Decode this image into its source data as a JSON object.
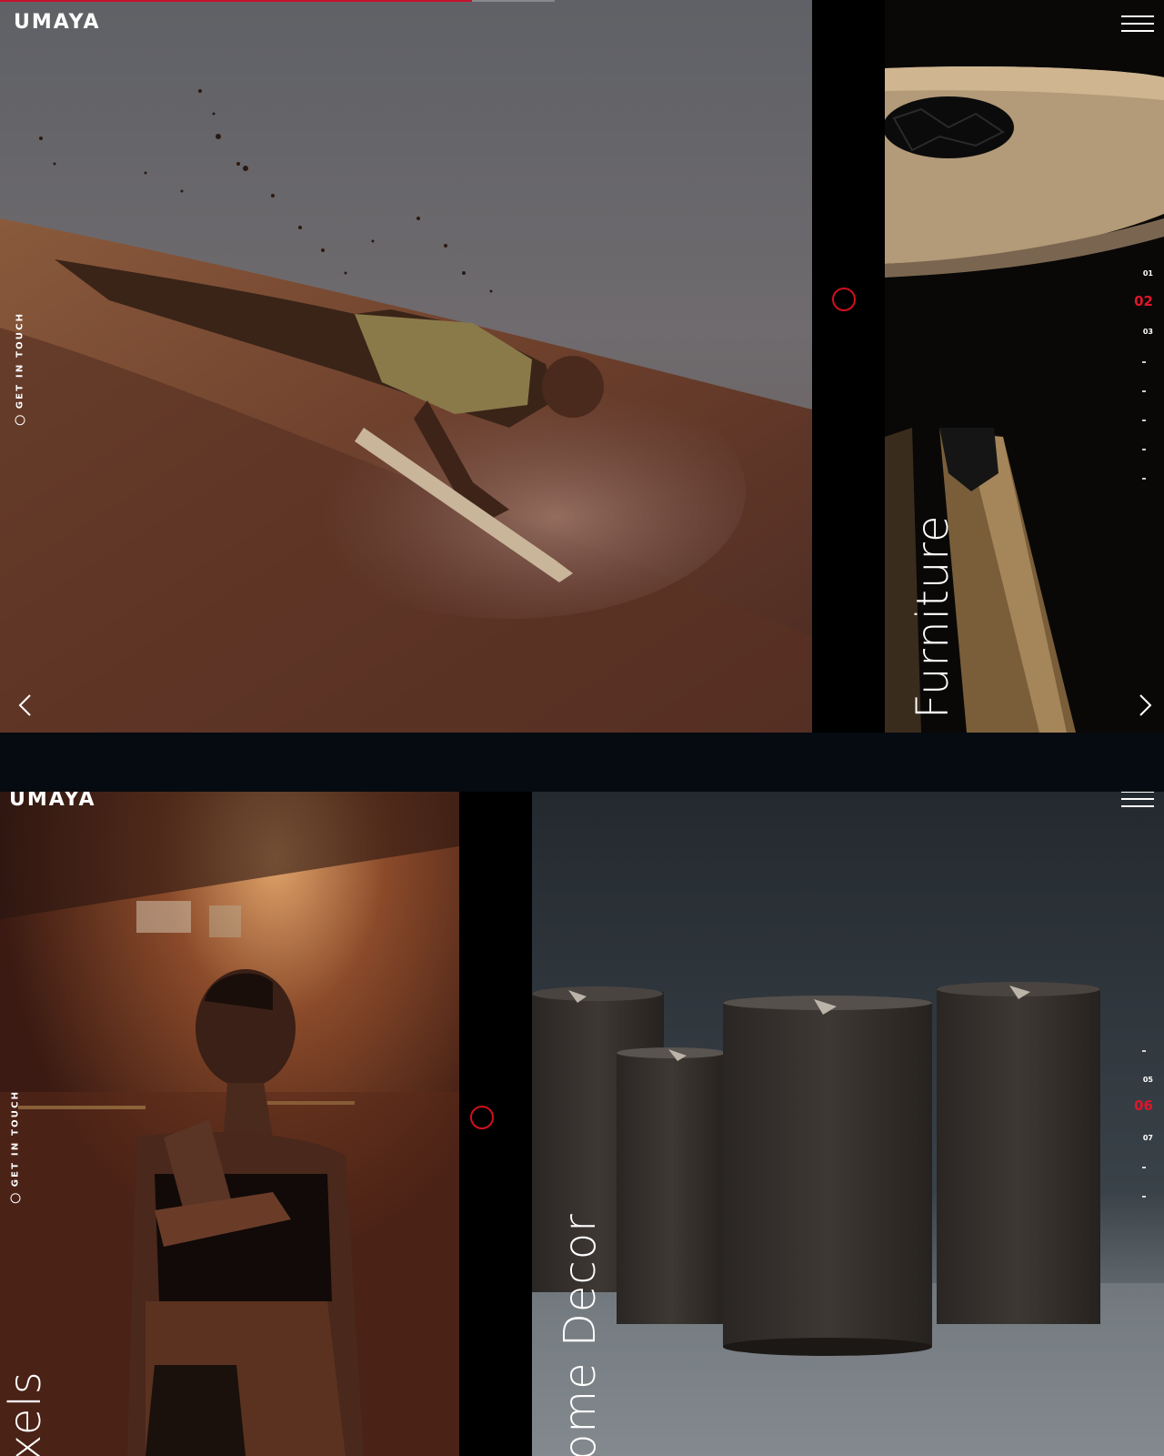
{
  "brand": {
    "logo_text": "UMAYA"
  },
  "colors": {
    "accent": "#d0101e",
    "background": "#000000"
  },
  "icons": {
    "menu": "hamburger-menu-icon",
    "contact": "chat-bubble-icon",
    "prev": "chevron-left-icon",
    "next": "chevron-right-icon",
    "slide_marker": "ring-icon"
  },
  "screens": [
    {
      "progress": 0.85,
      "get_in_touch": "GET IN TOUCH",
      "slide_title": "Furniture",
      "pager": {
        "items": [
          "01",
          "02",
          "03"
        ],
        "active": "02",
        "more_dots": 5
      }
    },
    {
      "get_in_touch": "GET IN TOUCH",
      "partial_title": "xels",
      "slide_title": "ome Decor",
      "pager": {
        "items": [
          "05",
          "06",
          "07"
        ],
        "active": "06",
        "more_dots": 3
      }
    }
  ]
}
